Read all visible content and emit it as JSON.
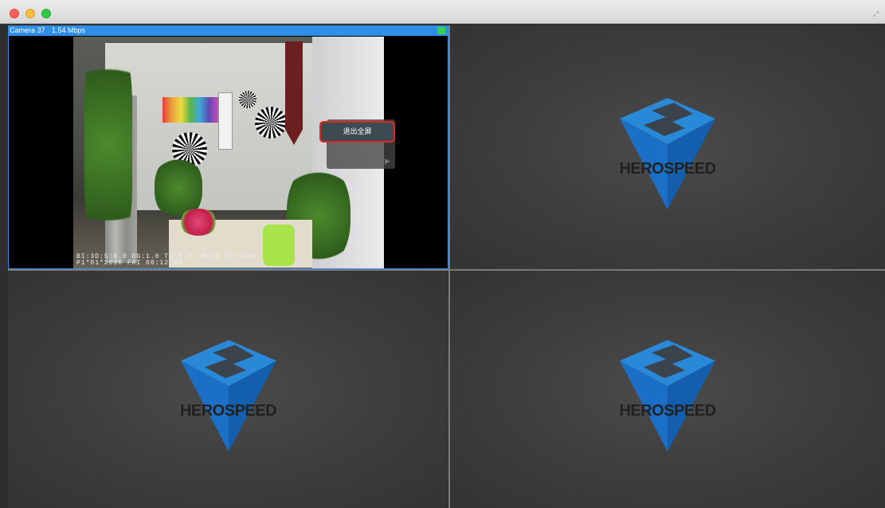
{
  "window": {
    "controls": [
      "close",
      "minimize",
      "maximize"
    ],
    "fullscreen_icon": "expand-icon"
  },
  "camera_1": {
    "name": "Camera 37",
    "bitrate": "1.54 Mbps",
    "status_color": "#37d24b",
    "osd_text": "BI:3D:5:0.0 DG:1.0 TG:1.0 LM:45 TP:5291\nP1*01*2016 FRI 08:12:08"
  },
  "context_menu": {
    "exit_fullscreen_label": "退出全屏"
  },
  "placeholder": {
    "brand_text": "HEROSPEED"
  },
  "colors": {
    "selection_border": "#3d8de6",
    "header_bar": "#2f8fe8",
    "menu_highlight": "#e3261d",
    "logo_blue": "#1b6fc4"
  }
}
